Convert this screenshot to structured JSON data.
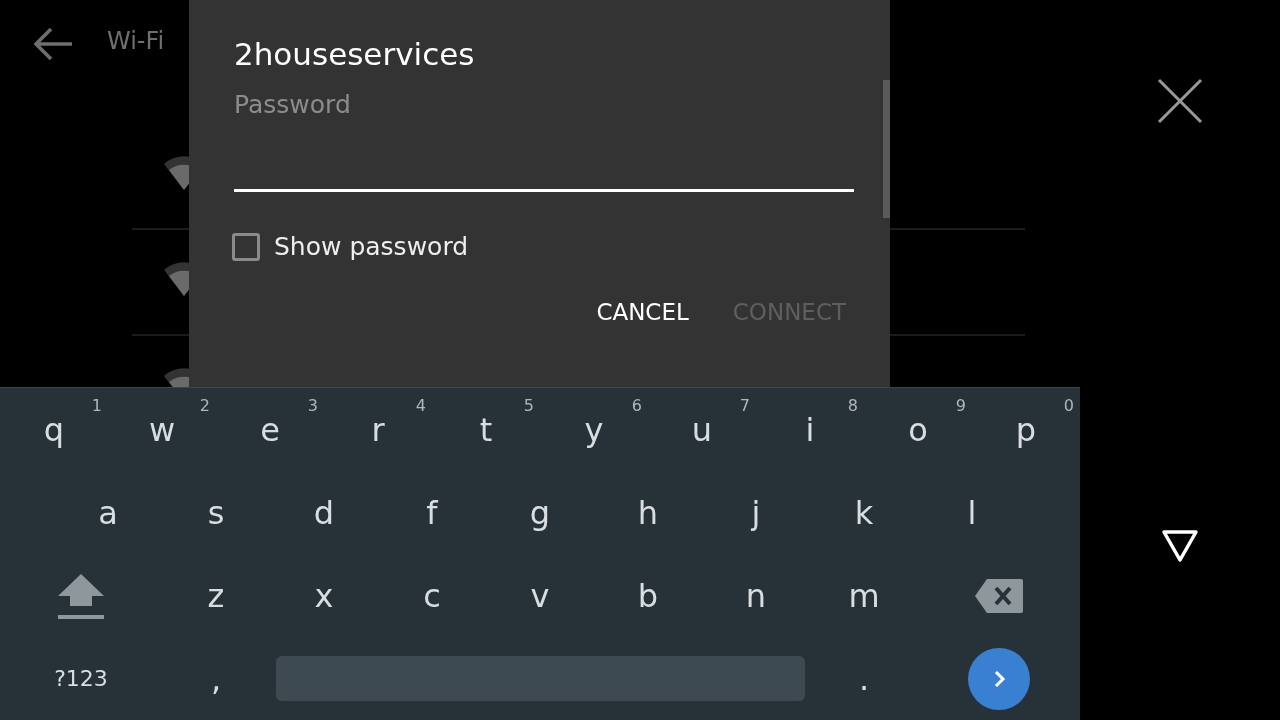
{
  "header": {
    "title": "Wi-Fi"
  },
  "dialog": {
    "title": "2houseservices",
    "password_label": "Password",
    "show_password": {
      "label": "Show password",
      "checked": false
    },
    "buttons": [
      {
        "label": "CANCEL",
        "disabled": false
      },
      {
        "label": "CONNECT",
        "disabled": true
      }
    ]
  },
  "keyboard": {
    "rows": [
      {
        "keys": [
          {
            "kind": "letter",
            "label": "q",
            "hint": "1"
          },
          {
            "kind": "letter",
            "label": "w",
            "hint": "2"
          },
          {
            "kind": "letter",
            "label": "e",
            "hint": "3"
          },
          {
            "kind": "letter",
            "label": "r",
            "hint": "4"
          },
          {
            "kind": "letter",
            "label": "t",
            "hint": "5"
          },
          {
            "kind": "letter",
            "label": "y",
            "hint": "6"
          },
          {
            "kind": "letter",
            "label": "u",
            "hint": "7"
          },
          {
            "kind": "letter",
            "label": "i",
            "hint": "8"
          },
          {
            "kind": "letter",
            "label": "o",
            "hint": "9"
          },
          {
            "kind": "letter",
            "label": "p",
            "hint": "0"
          }
        ]
      },
      {
        "keys": [
          {
            "kind": "letter",
            "label": "a"
          },
          {
            "kind": "letter",
            "label": "s"
          },
          {
            "kind": "letter",
            "label": "d"
          },
          {
            "kind": "letter",
            "label": "f"
          },
          {
            "kind": "letter",
            "label": "g"
          },
          {
            "kind": "letter",
            "label": "h"
          },
          {
            "kind": "letter",
            "label": "j"
          },
          {
            "kind": "letter",
            "label": "k"
          },
          {
            "kind": "letter",
            "label": "l"
          }
        ]
      },
      {
        "keys": [
          {
            "kind": "shift"
          },
          {
            "kind": "letter",
            "label": "z"
          },
          {
            "kind": "letter",
            "label": "x"
          },
          {
            "kind": "letter",
            "label": "c"
          },
          {
            "kind": "letter",
            "label": "v"
          },
          {
            "kind": "letter",
            "label": "b"
          },
          {
            "kind": "letter",
            "label": "n"
          },
          {
            "kind": "letter",
            "label": "m"
          },
          {
            "kind": "backspace"
          }
        ]
      },
      {
        "keys": [
          {
            "kind": "symbols",
            "label": "?123"
          },
          {
            "kind": "letter",
            "label": ","
          },
          {
            "kind": "space"
          },
          {
            "kind": "letter",
            "label": "."
          },
          {
            "kind": "enter"
          }
        ]
      }
    ]
  }
}
